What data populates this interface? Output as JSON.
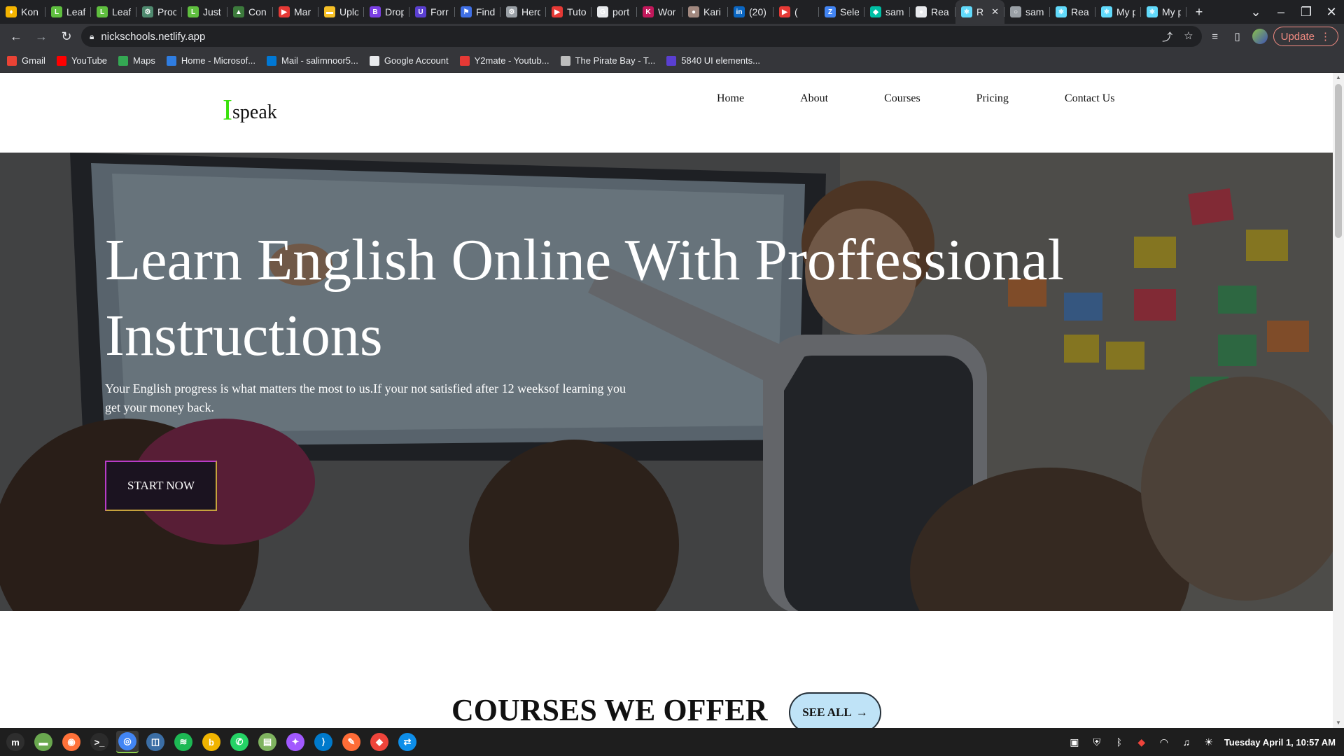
{
  "browser": {
    "tabs": [
      {
        "label": "Kon",
        "color": "#f4b400",
        "glyph": "♦"
      },
      {
        "label": "Leaf",
        "color": "#5fbf3f",
        "glyph": "L"
      },
      {
        "label": "Leaf",
        "color": "#5fbf3f",
        "glyph": "L"
      },
      {
        "label": "Proc",
        "color": "#4f8a6f",
        "glyph": "⚙"
      },
      {
        "label": "Just",
        "color": "#5fbf3f",
        "glyph": "L"
      },
      {
        "label": "Con",
        "color": "#3c7a3c",
        "glyph": "▲"
      },
      {
        "label": "Mar",
        "color": "#e53935",
        "glyph": "▶"
      },
      {
        "label": "Uplo",
        "color": "#f6c026",
        "glyph": "▬"
      },
      {
        "label": "Drop",
        "color": "#7b3fe4",
        "glyph": "B"
      },
      {
        "label": "Forr",
        "color": "#5a3fd1",
        "glyph": "U"
      },
      {
        "label": "Find",
        "color": "#3f6fe4",
        "glyph": "⚑"
      },
      {
        "label": "Herd",
        "color": "#9aa0a6",
        "glyph": "⚙"
      },
      {
        "label": "Tuto",
        "color": "#e53935",
        "glyph": "▶"
      },
      {
        "label": "port",
        "color": "#e8eaed",
        "glyph": "G"
      },
      {
        "label": "Wor",
        "color": "#c2185b",
        "glyph": "K"
      },
      {
        "label": "Kari",
        "color": "#a1887f",
        "glyph": "●"
      },
      {
        "label": "(20)",
        "color": "#0a66c2",
        "glyph": "in"
      },
      {
        "label": "(",
        "color": "#e53935",
        "glyph": "▶"
      },
      {
        "label": "Sele",
        "color": "#4285f4",
        "glyph": "Z"
      },
      {
        "label": "sam",
        "color": "#00bfa5",
        "glyph": "◆"
      },
      {
        "label": "Rea",
        "color": "#e8eaed",
        "glyph": "●"
      },
      {
        "label": "R",
        "color": "#61dafb",
        "glyph": "⚛",
        "active": true
      },
      {
        "label": "sam",
        "color": "#9aa0a6",
        "glyph": "○"
      },
      {
        "label": "Rea",
        "color": "#61dafb",
        "glyph": "⚛"
      },
      {
        "label": "My p",
        "color": "#61dafb",
        "glyph": "⚛"
      },
      {
        "label": "My p",
        "color": "#61dafb",
        "glyph": "⚛"
      }
    ],
    "new_tab": "+",
    "url": "nickschools.netlify.app",
    "update_label": "Update",
    "bookmarks": [
      {
        "label": "Gmail",
        "color": "#ea4335"
      },
      {
        "label": "YouTube",
        "color": "#ff0000"
      },
      {
        "label": "Maps",
        "color": "#34a853"
      },
      {
        "label": "Home - Microsof...",
        "color": "#2f7de1"
      },
      {
        "label": "Mail - salimnoor5...",
        "color": "#0078d4"
      },
      {
        "label": "Google Account",
        "color": "#e8eaed"
      },
      {
        "label": "Y2mate - Youtub...",
        "color": "#e53935"
      },
      {
        "label": "The Pirate Bay - T...",
        "color": "#bdbdbd"
      },
      {
        "label": "5840 UI elements...",
        "color": "#5a3fd1"
      }
    ]
  },
  "site": {
    "logo_initial": "I",
    "logo_rest": "speak",
    "nav": [
      "Home",
      "About",
      "Courses",
      "Pricing",
      "Contact Us"
    ],
    "hero_title": "Learn English Online With Proffessional Instructions",
    "hero_subtitle": "Your English progress is what matters the most to us.If your not satisfied after 12 weeksof learning you get your money back.",
    "cta_label": "START NOW",
    "courses_heading": "COURSES WE OFFER",
    "see_all_label": "SEE ALL",
    "see_all_arrow": "→"
  },
  "taskbar": {
    "apps": [
      {
        "name": "menu",
        "color": "#2e2e2e",
        "glyph": "m"
      },
      {
        "name": "files-green",
        "color": "#6aa84f",
        "glyph": "▬"
      },
      {
        "name": "firefox",
        "color": "#ff7139",
        "glyph": "◉"
      },
      {
        "name": "terminal",
        "color": "#2b2b2b",
        "glyph": ">_"
      },
      {
        "name": "chrome",
        "color": "#4285f4",
        "glyph": "◎",
        "active": true
      },
      {
        "name": "screenshot",
        "color": "#3b6ea5",
        "glyph": "◫"
      },
      {
        "name": "spotify",
        "color": "#1db954",
        "glyph": "≋"
      },
      {
        "name": "bitwarden",
        "color": "#f0b400",
        "glyph": "b"
      },
      {
        "name": "whatsapp",
        "color": "#25d366",
        "glyph": "✆"
      },
      {
        "name": "folder",
        "color": "#7fb35f",
        "glyph": "▤"
      },
      {
        "name": "figma",
        "color": "#a259ff",
        "glyph": "✦"
      },
      {
        "name": "vscode",
        "color": "#007acc",
        "glyph": "⟩"
      },
      {
        "name": "postman",
        "color": "#ff6c37",
        "glyph": "✎"
      },
      {
        "name": "anydesk",
        "color": "#ef443b",
        "glyph": "◆"
      },
      {
        "name": "teamviewer",
        "color": "#0e8ee9",
        "glyph": "⇄"
      }
    ],
    "clock": "Tuesday April  1, 10:57 AM"
  }
}
